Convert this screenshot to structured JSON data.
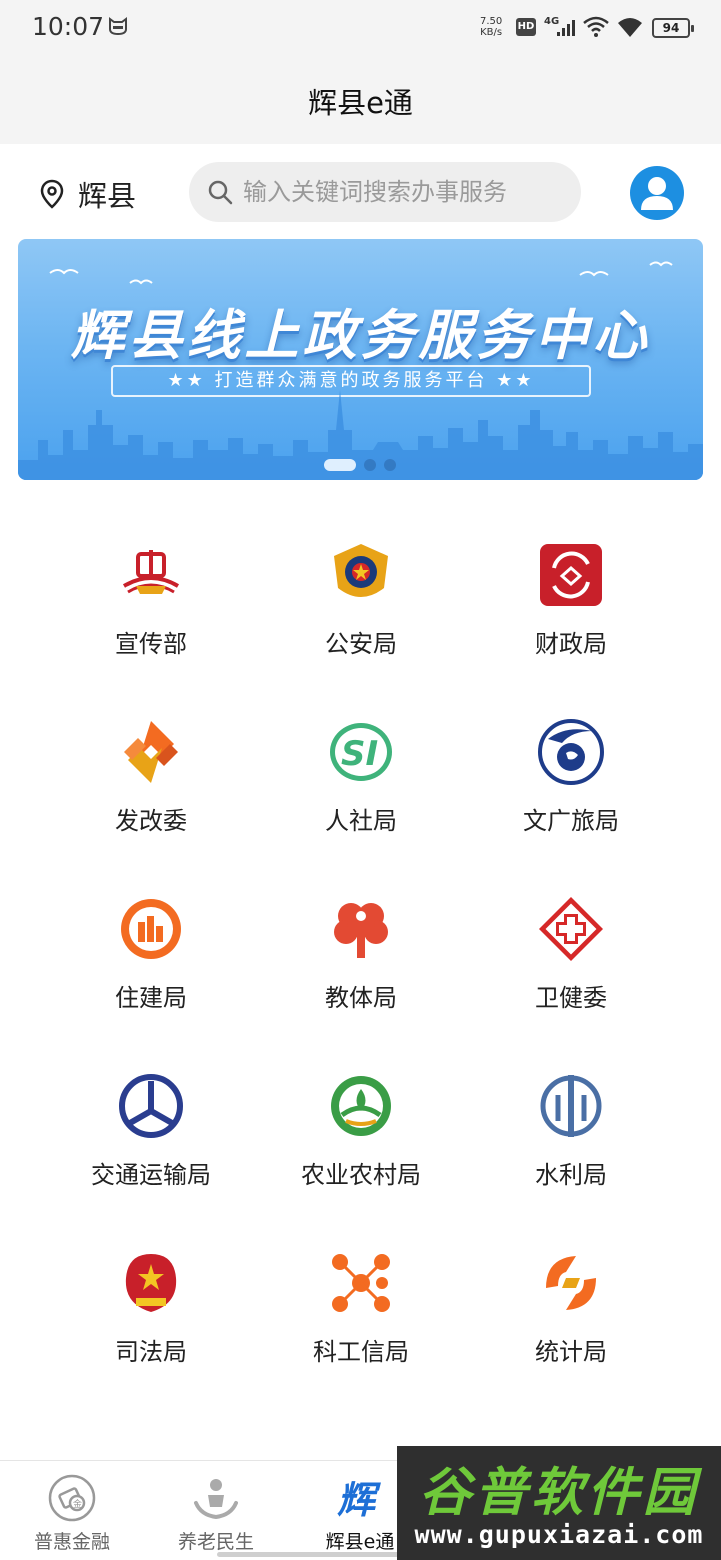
{
  "status_bar": {
    "time": "10:07",
    "speed_value": "7.50",
    "speed_unit": "KB/s",
    "network": "4G",
    "hd": "HD",
    "battery": "94"
  },
  "header": {
    "title": "辉县e通"
  },
  "location": {
    "city": "辉县"
  },
  "search": {
    "placeholder": "输入关键词搜索办事服务"
  },
  "banner": {
    "title": "辉县线上政务服务中心",
    "subtitle": "★★ 打造群众满意的政务服务平台 ★★",
    "slide_count": 3,
    "active_slide": 1
  },
  "departments": [
    {
      "label": "宣传部",
      "icon": "propaganda-dept-icon"
    },
    {
      "label": "公安局",
      "icon": "police-emblem-icon"
    },
    {
      "label": "财政局",
      "icon": "finance-bureau-icon"
    },
    {
      "label": "发改委",
      "icon": "development-reform-icon"
    },
    {
      "label": "人社局",
      "icon": "social-security-si-icon"
    },
    {
      "label": "文广旅局",
      "icon": "culture-tourism-icon"
    },
    {
      "label": "住建局",
      "icon": "housing-construction-icon"
    },
    {
      "label": "教体局",
      "icon": "education-sports-icon"
    },
    {
      "label": "卫健委",
      "icon": "health-commission-icon"
    },
    {
      "label": "交通运输局",
      "icon": "transport-bureau-icon"
    },
    {
      "label": "农业农村局",
      "icon": "agriculture-bureau-icon"
    },
    {
      "label": "水利局",
      "icon": "water-resources-icon"
    },
    {
      "label": "司法局",
      "icon": "justice-bureau-icon"
    },
    {
      "label": "科工信局",
      "icon": "sci-tech-industry-icon"
    },
    {
      "label": "统计局",
      "icon": "statistics-bureau-icon"
    }
  ],
  "bottom_nav": [
    {
      "label": "普惠金融",
      "icon": "inclusive-finance-icon",
      "active": false
    },
    {
      "label": "养老民生",
      "icon": "elderly-care-icon",
      "active": false
    },
    {
      "label": "辉县e通",
      "icon": "huixian-app-icon",
      "active": true
    }
  ],
  "watermark": {
    "title": "谷普软件园",
    "url": "www.gupuxiazai.com"
  },
  "colors": {
    "accent_blue": "#1d8fe1",
    "banner_blue": "#4aa1ee",
    "watermark_green": "#6fc93a"
  }
}
